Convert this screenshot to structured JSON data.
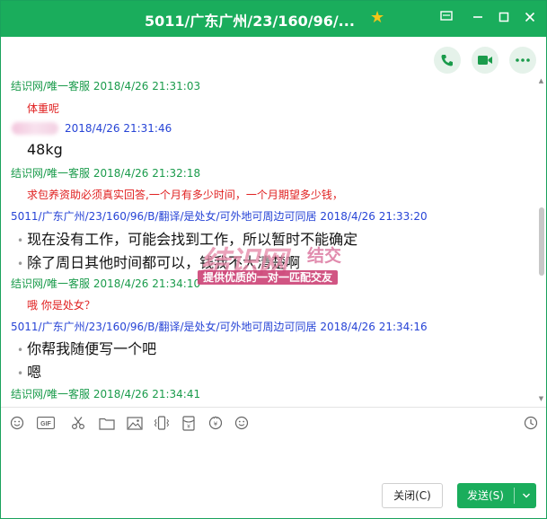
{
  "window": {
    "title": "5011/广东广州/23/160/96/...",
    "controls": [
      "settings-icon",
      "minimize-icon",
      "maximize-icon",
      "close-icon"
    ]
  },
  "toolbar": {
    "buttons": [
      "phone-icon",
      "video-icon",
      "more-icon"
    ]
  },
  "messages": [
    {
      "kind": "header",
      "color": "green",
      "text": "结识网/唯一客服 2018/4/26 21:31:03"
    },
    {
      "kind": "text-red",
      "text": "体重呢"
    },
    {
      "kind": "header-blurred",
      "color": "blue",
      "text": "2018/4/26 21:31:46"
    },
    {
      "kind": "text-big",
      "text": "48kg"
    },
    {
      "kind": "header",
      "color": "green",
      "text": "结识网/唯一客服 2018/4/26 21:32:18"
    },
    {
      "kind": "text-red",
      "text": "求包养资助必须真实回答,一个月有多少时间，一个月期望多少钱，"
    },
    {
      "kind": "header",
      "color": "blue",
      "text": "5011/广东广州/23/160/96/B/翻译/是处女/可外地可周边可同居 2018/4/26 21:33:20"
    },
    {
      "kind": "bullet",
      "text": "现在没有工作，可能会找到工作，所以暂时不能确定"
    },
    {
      "kind": "bullet",
      "text": "除了周日其他时间都可以，钱我不大清楚啊"
    },
    {
      "kind": "header",
      "color": "green",
      "text": "结识网/唯一客服 2018/4/26 21:34:10"
    },
    {
      "kind": "text-red",
      "text": "哦  你是处女？"
    },
    {
      "kind": "header",
      "color": "blue",
      "text": "5011/广东广州/23/160/96/B/翻译/是处女/可外地可周边可同居 2018/4/26 21:34:16"
    },
    {
      "kind": "bullet",
      "text": "你帮我随便写一个吧"
    },
    {
      "kind": "bullet",
      "text": "嗯"
    },
    {
      "kind": "header",
      "color": "green",
      "text": "结识网/唯一客服 2018/4/26 21:34:41"
    }
  ],
  "watermark": {
    "main": "结识网",
    "sub": "结交",
    "slogan": "提供优质的一对一匹配交友"
  },
  "input_tools": [
    "emoji-icon",
    "gif-icon",
    "scissors-icon",
    "folder-icon",
    "image-icon",
    "shake-icon",
    "red-packet-icon",
    "transfer-icon",
    "smile-icon",
    "history-clock-icon"
  ],
  "input": {
    "value": ""
  },
  "footer": {
    "close_label": "关闭(C)",
    "send_label": "发送(S)"
  },
  "colors": {
    "brand_green": "#1aad5c",
    "sender_green": "#1a9b4b",
    "sender_blue": "#2744d6",
    "message_red": "#e02020"
  }
}
